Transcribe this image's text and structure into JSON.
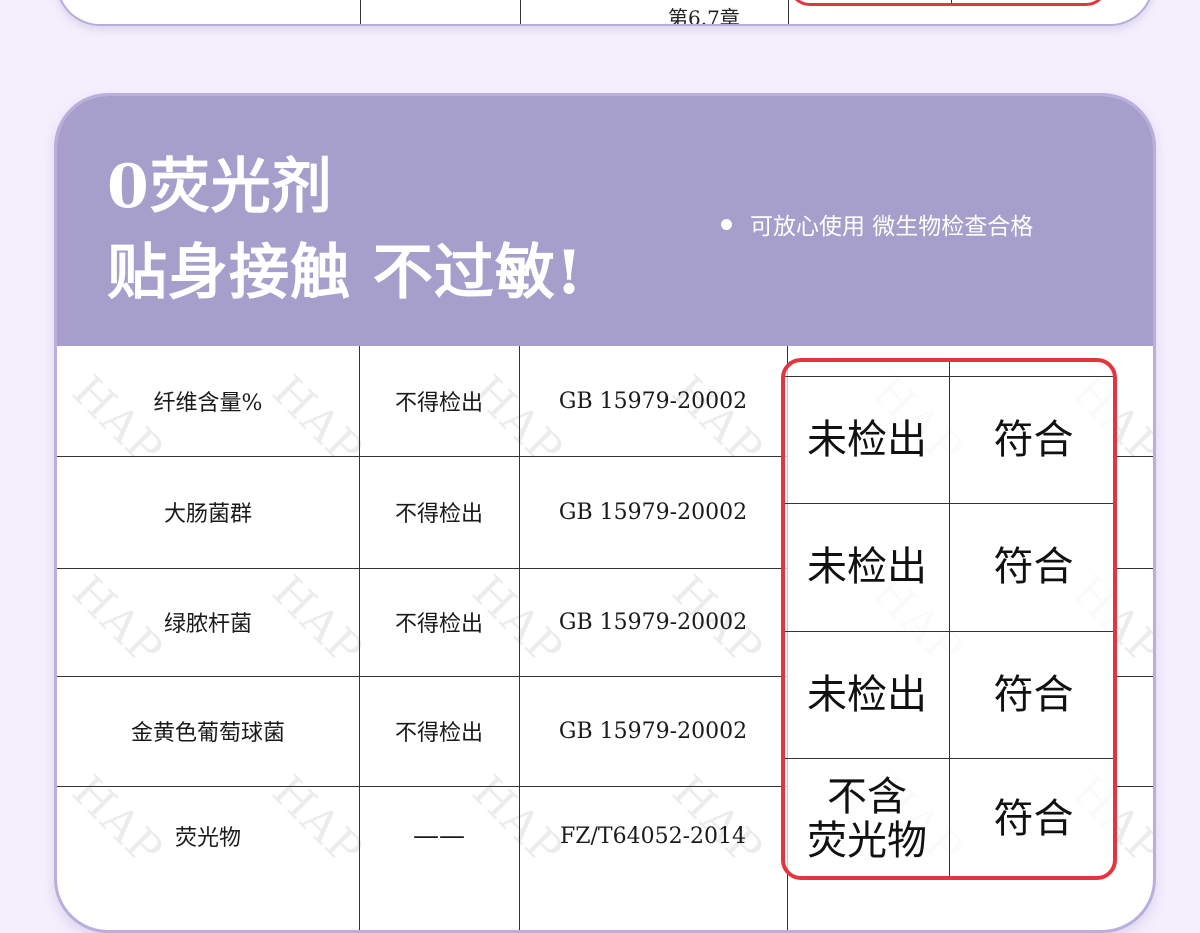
{
  "top_card": {
    "peek_text": "第6.7章"
  },
  "header": {
    "title_line1": "0荧光剂",
    "title_line2": "贴身接触 不过敏!",
    "note": "可放心使用 微生物检查合格"
  },
  "watermark": "HAP",
  "rows": [
    {
      "item": "纤维含量%",
      "requirement": "不得检出",
      "standard": "GB 15979-20002",
      "result": "未检出",
      "verdict": "符合"
    },
    {
      "item": "大肠菌群",
      "requirement": "不得检出",
      "standard": "GB 15979-20002",
      "result": "未检出",
      "verdict": "符合"
    },
    {
      "item": "绿脓杆菌",
      "requirement": "不得检出",
      "standard": "GB 15979-20002",
      "result": "未检出",
      "verdict": "符合"
    },
    {
      "item": "金黄色葡萄球菌",
      "requirement": "不得检出",
      "standard": "GB 15979-20002",
      "result": "",
      "verdict": ""
    },
    {
      "item": "荧光物",
      "requirement": "——",
      "standard": "FZ/T64052-2014",
      "result": "不含\n荧光物",
      "verdict": "符合"
    }
  ],
  "colors": {
    "header_bg": "#a69ecb",
    "page_bg": "#f4effd",
    "highlight": "#e4353f"
  }
}
